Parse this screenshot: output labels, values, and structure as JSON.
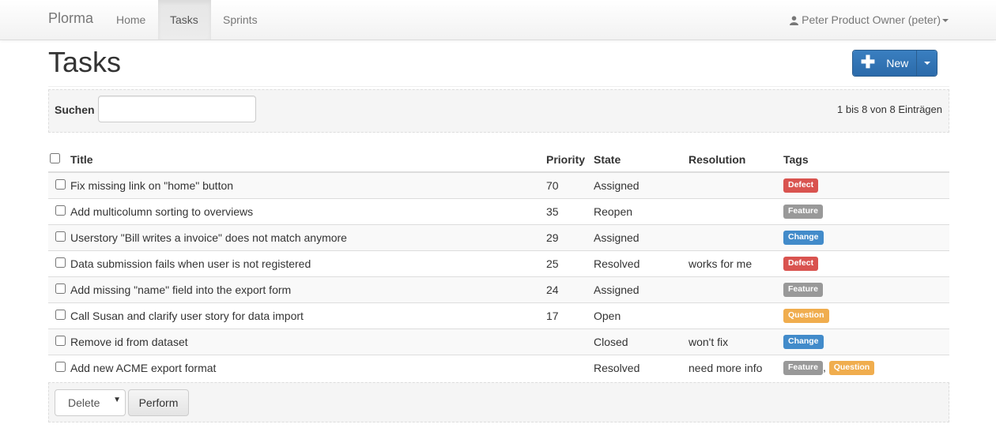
{
  "navbar": {
    "brand": "Plorma",
    "items": [
      {
        "label": "Home",
        "active": false
      },
      {
        "label": "Tasks",
        "active": true
      },
      {
        "label": "Sprints",
        "active": false
      }
    ],
    "user": "Peter Product Owner (peter)"
  },
  "page": {
    "title": "Tasks",
    "new_button": "New"
  },
  "search": {
    "label": "Suchen",
    "value": "",
    "info": "1 bis 8 von 8 Einträgen"
  },
  "table": {
    "headers": {
      "title": "Title",
      "priority": "Priority",
      "state": "State",
      "resolution": "Resolution",
      "tags": "Tags"
    },
    "rows": [
      {
        "title": "Fix missing link on \"home\" button",
        "priority": "70",
        "state": "Assigned",
        "resolution": "",
        "tags": [
          {
            "label": "Defect",
            "kind": "defect"
          }
        ]
      },
      {
        "title": "Add multicolumn sorting to overviews",
        "priority": "35",
        "state": "Reopen",
        "resolution": "",
        "tags": [
          {
            "label": "Feature",
            "kind": "feature"
          }
        ]
      },
      {
        "title": "Userstory \"Bill writes a invoice\" does not match anymore",
        "priority": "29",
        "state": "Assigned",
        "resolution": "",
        "tags": [
          {
            "label": "Change",
            "kind": "change"
          }
        ]
      },
      {
        "title": "Data submission fails when user is not registered",
        "priority": "25",
        "state": "Resolved",
        "resolution": "works for me",
        "tags": [
          {
            "label": "Defect",
            "kind": "defect"
          }
        ]
      },
      {
        "title": "Add missing \"name\" field into the export form",
        "priority": "24",
        "state": "Assigned",
        "resolution": "",
        "tags": [
          {
            "label": "Feature",
            "kind": "feature"
          }
        ]
      },
      {
        "title": "Call Susan and clarify user story for data import",
        "priority": "17",
        "state": "Open",
        "resolution": "",
        "tags": [
          {
            "label": "Question",
            "kind": "question"
          }
        ]
      },
      {
        "title": "Remove id from dataset",
        "priority": "",
        "state": "Closed",
        "resolution": "won't fix",
        "tags": [
          {
            "label": "Change",
            "kind": "change"
          }
        ]
      },
      {
        "title": "Add new ACME export format",
        "priority": "",
        "state": "Resolved",
        "resolution": "need more info",
        "tags": [
          {
            "label": "Feature",
            "kind": "feature"
          },
          {
            "label": "Question",
            "kind": "question"
          }
        ]
      }
    ]
  },
  "actions": {
    "selected": "Delete",
    "perform": "Perform"
  },
  "colors": {
    "defect": "#d9534f",
    "feature": "#999999",
    "change": "#428bca",
    "question": "#f0ad4e",
    "primary": "#3071a9"
  }
}
